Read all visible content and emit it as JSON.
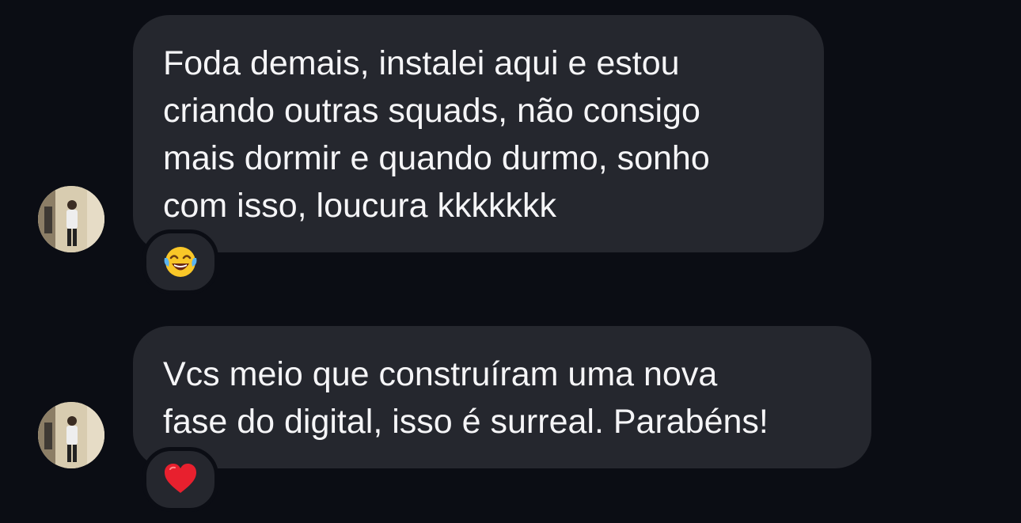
{
  "conversation": {
    "messages": [
      {
        "text": "Foda demais, instalei aqui e estou\ncriando outras squads, não consigo\nmais dormir e quando durmo, sonho\ncom isso, loucura kkkkkkk",
        "reaction": "face-with-tears-of-joy-emoji"
      },
      {
        "text": "Vcs meio que construíram uma nova\nfase do digital, isso é surreal. Parabéns!",
        "reaction": "red-heart-emoji"
      }
    ]
  },
  "colors": {
    "background": "#0b0d14",
    "bubble": "#25272e",
    "text": "#f5f5f7"
  }
}
